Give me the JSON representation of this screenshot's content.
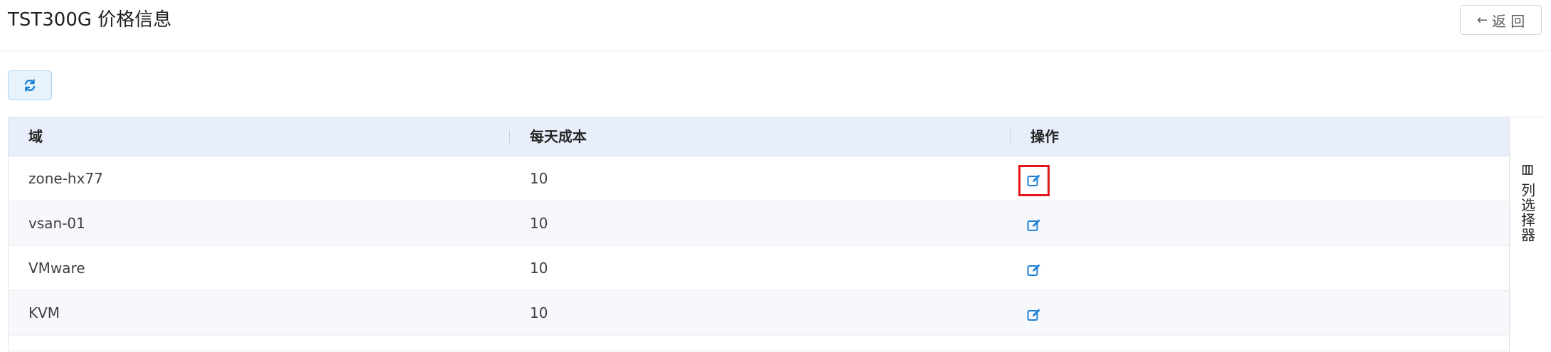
{
  "page": {
    "title": "TST300G 价格信息",
    "back_label": "返 回"
  },
  "toolbar": {
    "refresh_icon": "refresh-icon",
    "accent": "#1a7fd4"
  },
  "table": {
    "columns": [
      "域",
      "每天成本",
      "操作"
    ],
    "rows": [
      {
        "domain": "zone-hx77",
        "daily_cost": "10",
        "action_icon": "edit-icon",
        "highlighted": true
      },
      {
        "domain": "vsan-01",
        "daily_cost": "10",
        "action_icon": "edit-icon",
        "highlighted": false
      },
      {
        "domain": "VMware",
        "daily_cost": "10",
        "action_icon": "edit-icon",
        "highlighted": false
      },
      {
        "domain": "KVM",
        "daily_cost": "10",
        "action_icon": "edit-icon",
        "highlighted": false
      }
    ]
  },
  "column_picker": {
    "label": "列选择器",
    "icon": "columns-icon"
  },
  "colors": {
    "header_bg": "#e8eefb",
    "highlight_border": "#e0161a",
    "icon_blue": "#1a7fd4"
  }
}
